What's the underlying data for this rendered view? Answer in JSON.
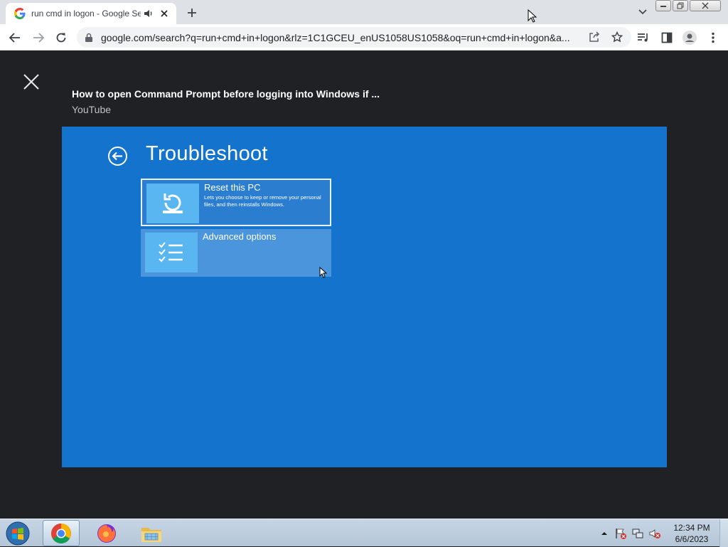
{
  "browser": {
    "tab": {
      "title": "run cmd in logon - Google Search",
      "favicon": "google-g-icon",
      "audio_icon": "speaker-icon",
      "close_icon": "close-icon"
    },
    "new_tab_icon": "plus-icon",
    "tab_search_icon": "chevron-down-icon",
    "url": "google.com/search?q=run+cmd+in+logon&rlz=1C1GCEU_enUS1058US1058&oq=run+cmd+in+logon&a..."
  },
  "viewer": {
    "close_icon": "close-icon",
    "title": "How to open Command Prompt before logging into Windows if ...",
    "source": "YouTube",
    "video": {
      "heading": "Troubleshoot",
      "options": [
        {
          "name": "Reset this PC",
          "description": "Lets you choose to keep or remove your personal files, and then reinstalls Windows."
        },
        {
          "name": "Advanced options",
          "description": ""
        }
      ]
    }
  },
  "taskbar": {
    "clock_time": "12:34 PM",
    "clock_date": "6/6/2023",
    "apps": [
      "chrome-icon",
      "firefox-icon",
      "file-explorer-icon"
    ]
  },
  "colors": {
    "video_bg": "#1473cc",
    "viewer_bg": "#202124",
    "tile_highlight": "#4a95dc"
  }
}
